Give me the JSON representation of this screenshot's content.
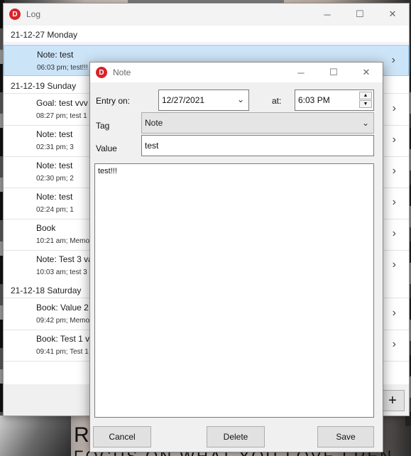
{
  "background": {
    "text_line1": "R",
    "text_line2": "FOCUS ON WHAT YOU LOVE  FREN"
  },
  "log_window": {
    "title": "Log",
    "icon_letter": "D",
    "groups": [
      {
        "date": "21-12-27 Monday"
      },
      {
        "date": "21-12-19 Sunday"
      },
      {
        "date": "21-12-18 Saturday"
      }
    ],
    "items": [
      {
        "title": "Note: test",
        "sub": "06:03 pm; test!!!",
        "selected": true
      },
      {
        "title": "Goal: test vvv",
        "sub": "08:27 pm; test 1"
      },
      {
        "title": "Note: test",
        "sub": "02:31 pm; 3"
      },
      {
        "title": "Note: test",
        "sub": "02:30 pm; 2"
      },
      {
        "title": "Note: test",
        "sub": "02:24 pm; 1"
      },
      {
        "title": "Book",
        "sub": "10:21 am; Memo"
      },
      {
        "title": "Note: Test 3 va",
        "sub": "10:03 am; test 3"
      },
      {
        "title": "Book: Value 2",
        "sub": "09:42 pm; Memo"
      },
      {
        "title": "Book: Test 1 va",
        "sub": "09:41 pm; Test 1"
      }
    ],
    "add_label": "+"
  },
  "note_dialog": {
    "title": "Note",
    "icon_letter": "D",
    "entry_on_label": "Entry on:",
    "date_value": "12/27/2021",
    "at_label": "at:",
    "time_value": "6:03 PM",
    "tag_label": "Tag",
    "tag_value": "Note",
    "value_label": "Value",
    "value_value": "test",
    "memo_text": "test!!!",
    "cancel_label": "Cancel",
    "delete_label": "Delete",
    "save_label": "Save"
  },
  "icons": {
    "minimize": "─",
    "maximize": "☐",
    "close": "✕",
    "chevron_right": "›",
    "chevron_down": "⌄",
    "spin_up": "▲",
    "spin_down": "▼"
  },
  "colors": {
    "selection": "#cce4f7",
    "app_icon": "#d8232a"
  }
}
